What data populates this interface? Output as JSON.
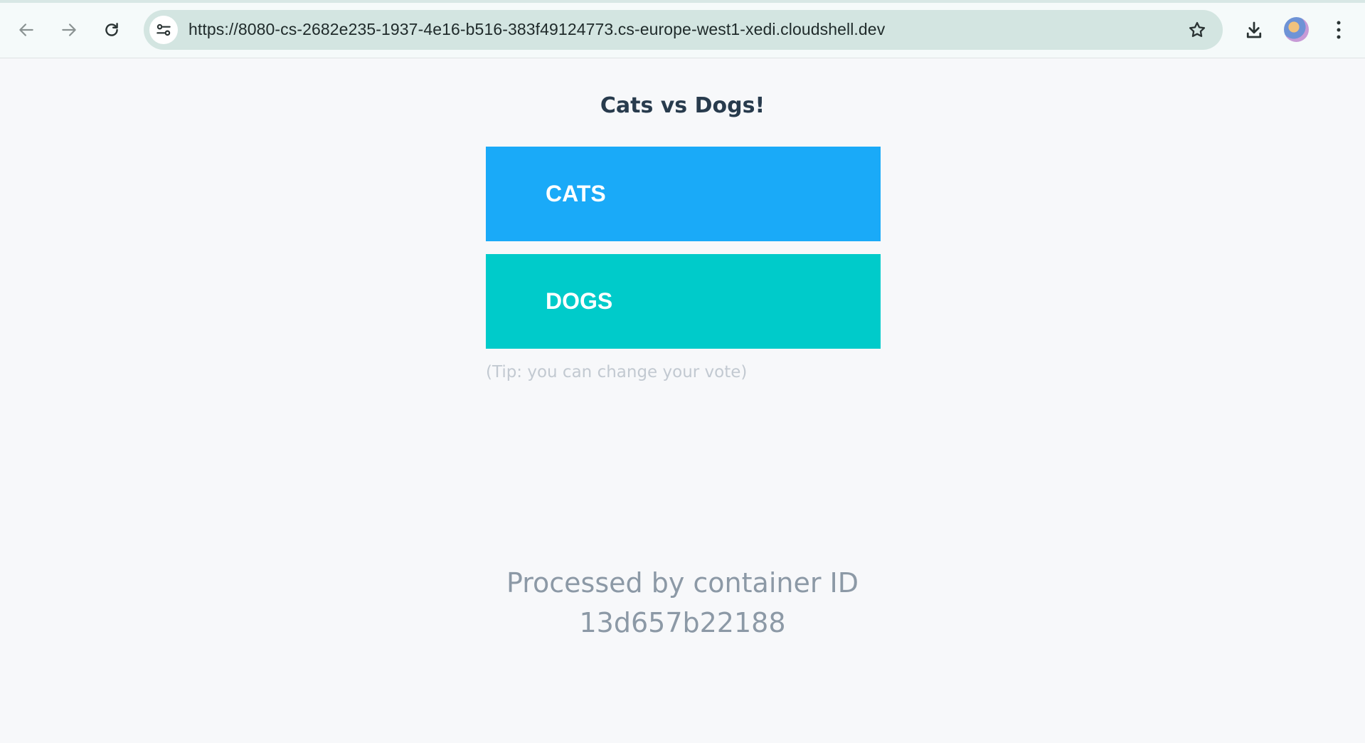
{
  "browser": {
    "url": "https://8080-cs-2682e235-1937-4e16-b516-383f49124773.cs-europe-west1-xedi.cloudshell.dev",
    "icons": {
      "back": "arrow-left-icon",
      "forward": "arrow-right-icon",
      "reload": "reload-icon",
      "site_info": "tune-icon",
      "bookmark": "star-icon",
      "download": "download-icon",
      "menu": "kebab-menu-icon"
    }
  },
  "page": {
    "title": "Cats vs Dogs!",
    "option_a": "CATS",
    "option_b": "DOGS",
    "tip": "(Tip: you can change your vote)",
    "processed_by_label": "Processed by container ID",
    "container_id": "13d657b22188"
  },
  "colors": {
    "option_a": "#1aaaf8",
    "option_b": "#00cbca",
    "title": "#283b4d",
    "background": "#f7f8fa"
  }
}
